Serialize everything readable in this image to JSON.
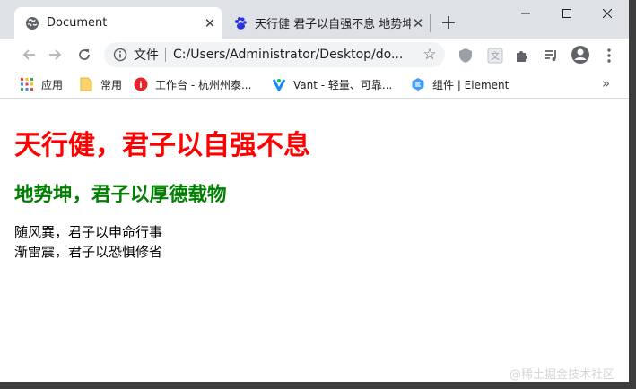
{
  "tabs": [
    {
      "title": "Document",
      "active": true,
      "icon": "globe-icon"
    },
    {
      "title": "天行健 君子以自强不息 地势坤",
      "active": false,
      "icon": "baidu-paw-icon"
    }
  ],
  "address_bar": {
    "scheme_label": "文件",
    "url": "C:/Users/Administrator/Desktop/do..."
  },
  "bookmarks": [
    {
      "label": "应用",
      "icon": "apps-grid-icon"
    },
    {
      "label": "常用",
      "icon": "folder-icon"
    },
    {
      "label": "工作台 - 杭州州泰...",
      "icon": "workbench-icon"
    },
    {
      "label": "Vant - 轻量、可靠...",
      "icon": "vant-icon"
    },
    {
      "label": "组件 | Element",
      "icon": "element-icon"
    }
  ],
  "content": {
    "h1": "天行健，君子以自强不息",
    "h2": "地势坤，君子以厚德载物",
    "lines": [
      "随风巽，君子以申命行事",
      "渐雷震，君子以恐惧修省"
    ]
  },
  "watermark": "@稀土掘金技术社区",
  "colors": {
    "h1": "#ff0000",
    "h2": "#008000",
    "tabstrip": "#dee1e6",
    "omnibox": "#f1f3f4"
  }
}
